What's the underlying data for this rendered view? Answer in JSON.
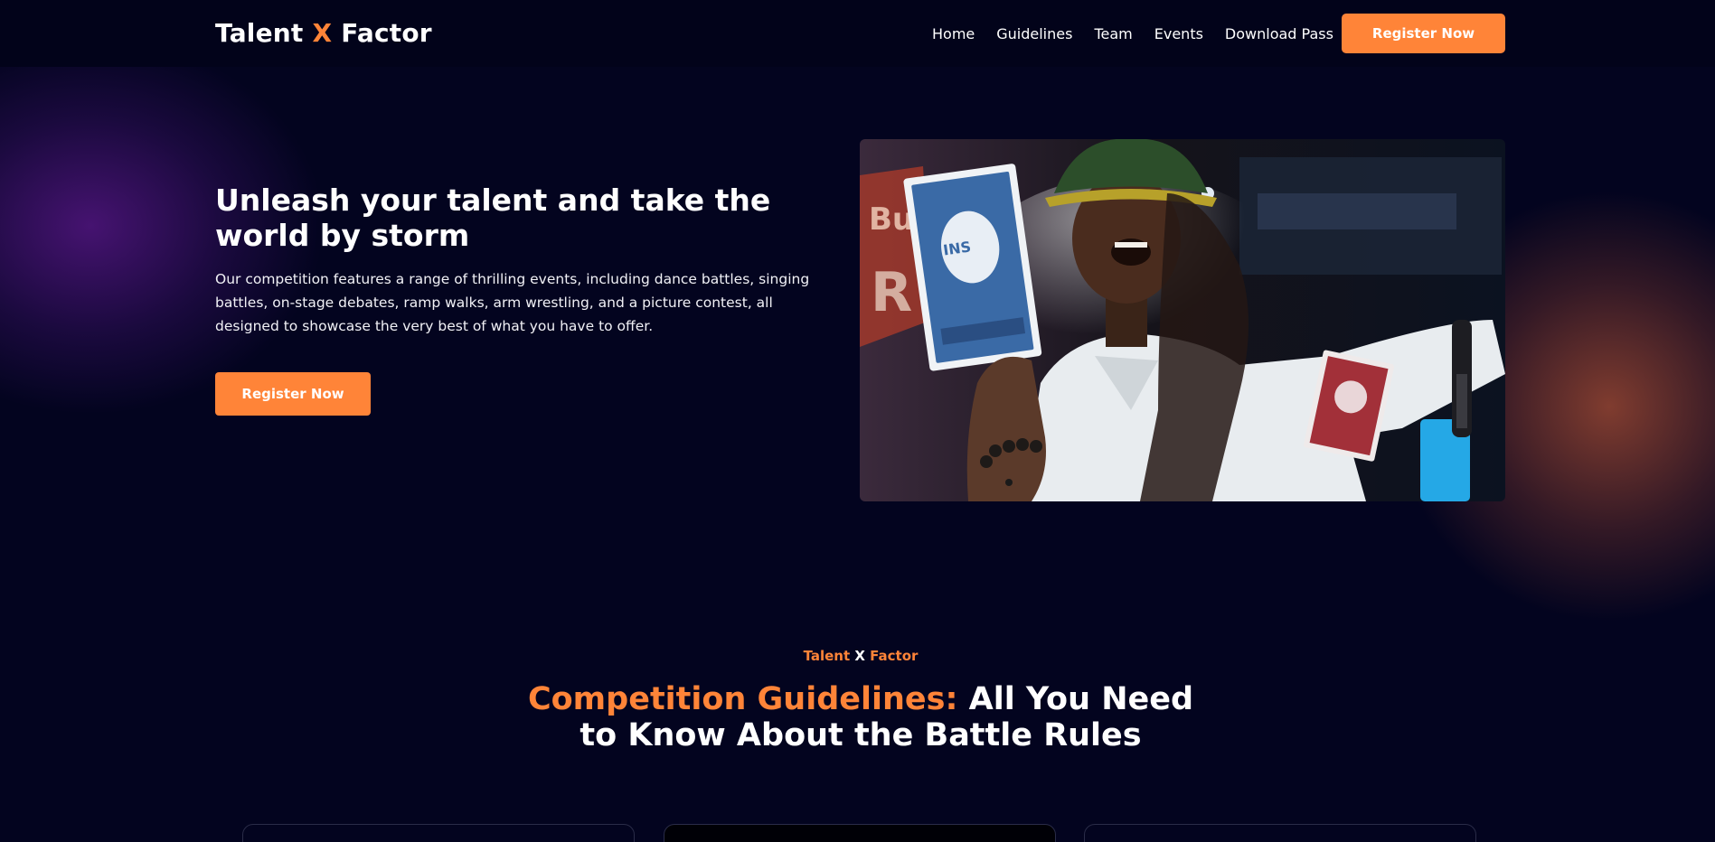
{
  "header": {
    "logo": {
      "part1": "Talent ",
      "x": "X",
      "part2": " Factor"
    },
    "nav": [
      "Home",
      "Guidelines",
      "Team",
      "Events",
      "Download Pass"
    ],
    "cta_label": "Register Now"
  },
  "hero": {
    "title": "Unleash your talent and take the world by storm",
    "description": "Our competition features a range of thrilling events, including dance battles, singing battles, on-stage debates, ramp walks, arm wrestling, and a picture contest, all designed to showcase the very best of what you have to offer.",
    "cta_label": "Register Now"
  },
  "section": {
    "eyebrow": {
      "part1": "Talent ",
      "x": "X",
      "part2": " Factor"
    },
    "title_highlight": "Competition Guidelines:",
    "title_rest": " All You Need to Know About the Battle Rules"
  },
  "colors": {
    "accent": "#ff8438",
    "background": "#03041f",
    "header_bg": "#02031a"
  }
}
